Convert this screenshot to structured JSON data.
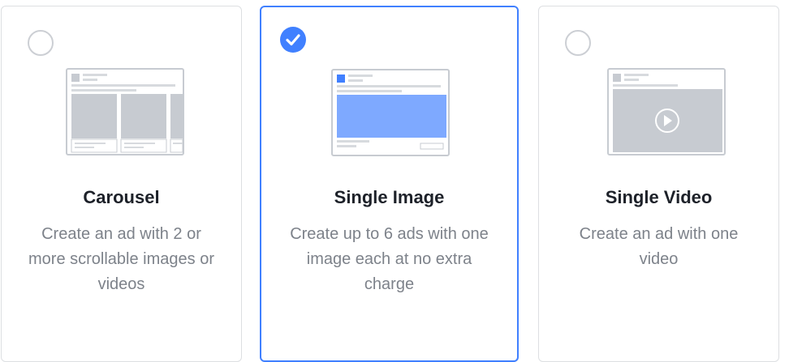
{
  "options": [
    {
      "title": "Carousel",
      "description": "Create an ad with 2 or more scrollable images or videos",
      "selected": false,
      "icon": "carousel-preview-icon"
    },
    {
      "title": "Single Image",
      "description": "Create up to 6 ads with one image each at no extra charge",
      "selected": true,
      "icon": "single-image-preview-icon"
    },
    {
      "title": "Single Video",
      "description": "Create an ad with one video",
      "selected": false,
      "icon": "single-video-preview-icon"
    }
  ],
  "colors": {
    "accent": "#4080ff",
    "border": "#dddfe2",
    "title": "#1d2129",
    "description": "#7d828a",
    "placeholder": "#c7cbd1"
  }
}
